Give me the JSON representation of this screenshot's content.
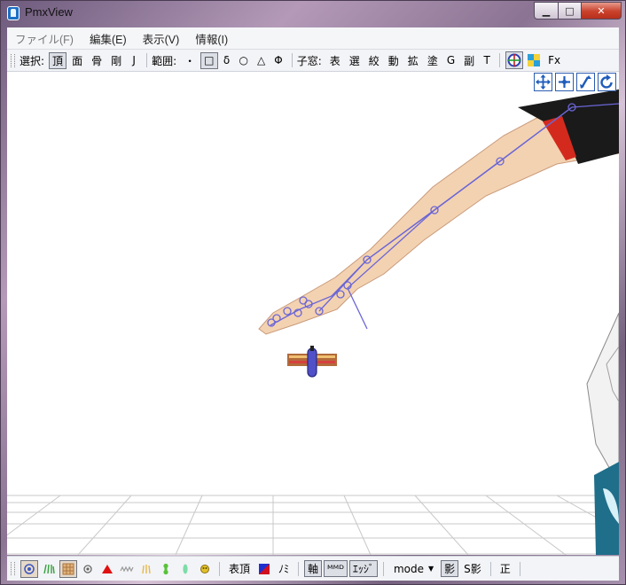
{
  "window": {
    "title": "PmxView",
    "min_glyph": "▁",
    "max_glyph": "□",
    "close_glyph": "✕"
  },
  "menu": [
    "ファイル(F)",
    "編集(E)",
    "表示(V)",
    "情報(I)"
  ],
  "toolbar": {
    "select_label": "選択:",
    "select_buttons": [
      "頂",
      "面",
      "骨",
      "剛",
      "J"
    ],
    "select_active": "頂",
    "range_label": "範囲:",
    "range_buttons": [
      "・",
      "□",
      "δ",
      "○",
      "△",
      "Φ"
    ],
    "range_active": "□",
    "child_label": "子窓:",
    "child_buttons": [
      "表",
      "選",
      "絞",
      "動",
      "拡",
      "塗",
      "G",
      "副",
      "T"
    ],
    "fx_label": "Fx"
  },
  "viewport": {
    "nav_icons": [
      "move-view-icon",
      "pan-icon",
      "zoom-icon",
      "rotate-icon"
    ],
    "colors": {
      "background": "#ffffff",
      "bone_line": "#6b66d6",
      "skin": "#f3d2b1",
      "grid": "#c8c8c8"
    }
  },
  "statusbar": {
    "icons": [
      "vertex-display-icon",
      "normal-display-icon",
      "texture-display-icon",
      "point-display-icon",
      "triangle-icon",
      "wire-icon",
      "weight-icon",
      "bone-icon",
      "ik-icon",
      "morph-icon"
    ],
    "vertex_label": "表頂",
    "mirror_label": "ﾉﾐ",
    "axis_label": "軸",
    "mmd_label": "ᴹᴹᴰ",
    "edge_label": "ｴｯｼﾞ",
    "mode_label": "mode",
    "shadow_label": "影",
    "s_shadow_label": "S影",
    "front_label": "正"
  }
}
